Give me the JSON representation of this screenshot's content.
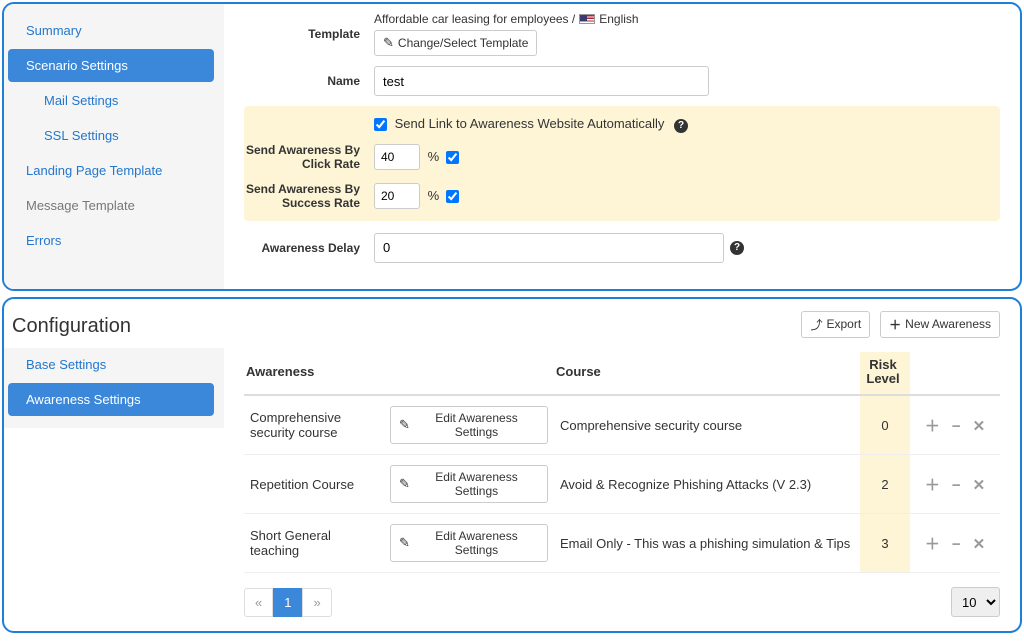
{
  "sidebar1": [
    {
      "label": "Summary",
      "cls": ""
    },
    {
      "label": "Scenario Settings",
      "cls": "active"
    },
    {
      "label": "Mail Settings",
      "cls": "sidebar-sub"
    },
    {
      "label": "SSL Settings",
      "cls": "sidebar-sub"
    },
    {
      "label": "Landing Page Template",
      "cls": ""
    },
    {
      "label": "Message Template",
      "cls": "muted"
    },
    {
      "label": "Errors",
      "cls": ""
    }
  ],
  "form": {
    "template_label": "Template",
    "template_value_pre": "Affordable car leasing for employees /",
    "template_value_lang": "English",
    "change_btn": "Change/Select Template",
    "name_label": "Name",
    "name_value": "test",
    "auto_label": "Send Link to Awareness Website Automatically",
    "click_label": "Send Awareness By Click Rate",
    "click_value": "40",
    "success_label": "Send Awareness By Success Rate",
    "success_value": "20",
    "pct": "%",
    "delay_label": "Awareness Delay",
    "delay_value": "0"
  },
  "config": {
    "title": "Configuration",
    "sidebar": [
      {
        "label": "Base Settings",
        "cls": ""
      },
      {
        "label": "Awareness Settings",
        "cls": "active"
      }
    ],
    "export_btn": "Export",
    "new_btn": "New Awareness",
    "headers": {
      "awareness": "Awareness",
      "course": "Course",
      "risk": "Risk Level"
    },
    "edit_btn": "Edit Awareness Settings",
    "rows": [
      {
        "name": "Comprehensive security course",
        "course": "Comprehensive security course",
        "risk": "0"
      },
      {
        "name": "Repetition Course",
        "course": "Avoid & Recognize Phishing Attacks (V 2.3)",
        "risk": "2"
      },
      {
        "name": "Short General teaching",
        "course": "Email Only - This was a phishing simulation & Tips",
        "risk": "3"
      }
    ],
    "page": "1",
    "pagesize": "10"
  },
  "chart_data": {
    "type": "table",
    "title": "Awareness configuration list",
    "columns": [
      "Awareness",
      "Course",
      "Risk Level"
    ],
    "rows": [
      [
        "Comprehensive security course",
        "Comprehensive security course",
        0
      ],
      [
        "Repetition Course",
        "Avoid & Recognize Phishing Attacks (V 2.3)",
        2
      ],
      [
        "Short General teaching",
        "Email Only - This was a phishing simulation & Tips",
        3
      ]
    ]
  }
}
